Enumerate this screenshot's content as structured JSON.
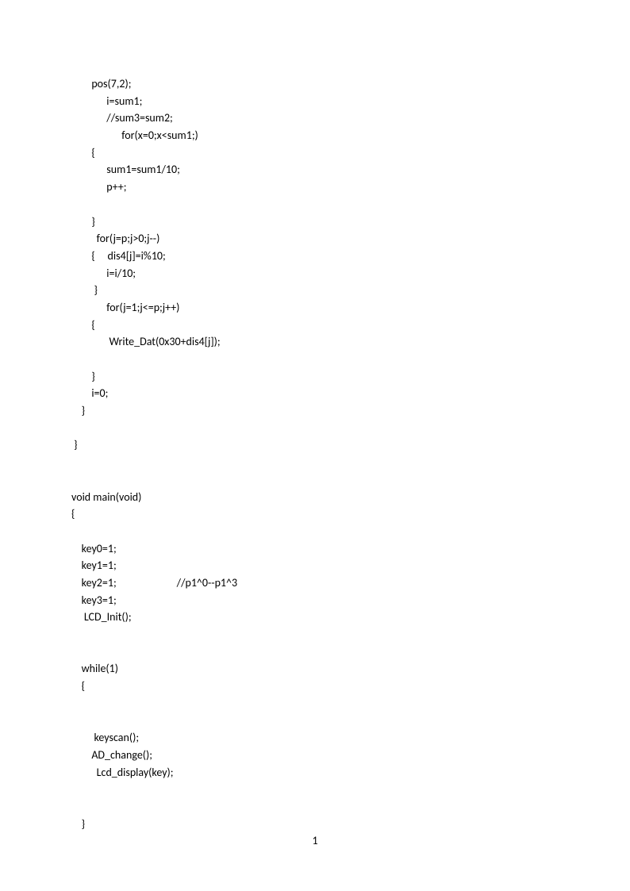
{
  "code": {
    "lines": [
      "        pos(7,2);",
      "              i=sum1;",
      "              //sum3=sum2;",
      "                    for(x=0;x<sum1;)",
      "        {",
      "              sum1=sum1/10;",
      "              p++;",
      "",
      "        }",
      "          for(j=p;j>0;j--)",
      "        {     dis4[j]=i%10;",
      "              i=i/10;",
      "         }",
      "              for(j=1;j<=p;j++)",
      "        {",
      "               Write_Dat(0x30+dis4[j]);",
      "",
      "        }",
      "        i=0;",
      "    }",
      "",
      " }",
      "",
      "",
      "void main(void)",
      "{",
      "",
      "    key0=1;",
      "    key1=1;",
      "    key2=1;                        //p1^0--p1^3",
      "    key3=1;",
      "     LCD_Init();",
      "",
      "",
      "    while(1)",
      "    {",
      "",
      "",
      "         keyscan();",
      "        AD_change();",
      "          Lcd_display(key);",
      "",
      "",
      "    }"
    ]
  },
  "page_number": "1"
}
